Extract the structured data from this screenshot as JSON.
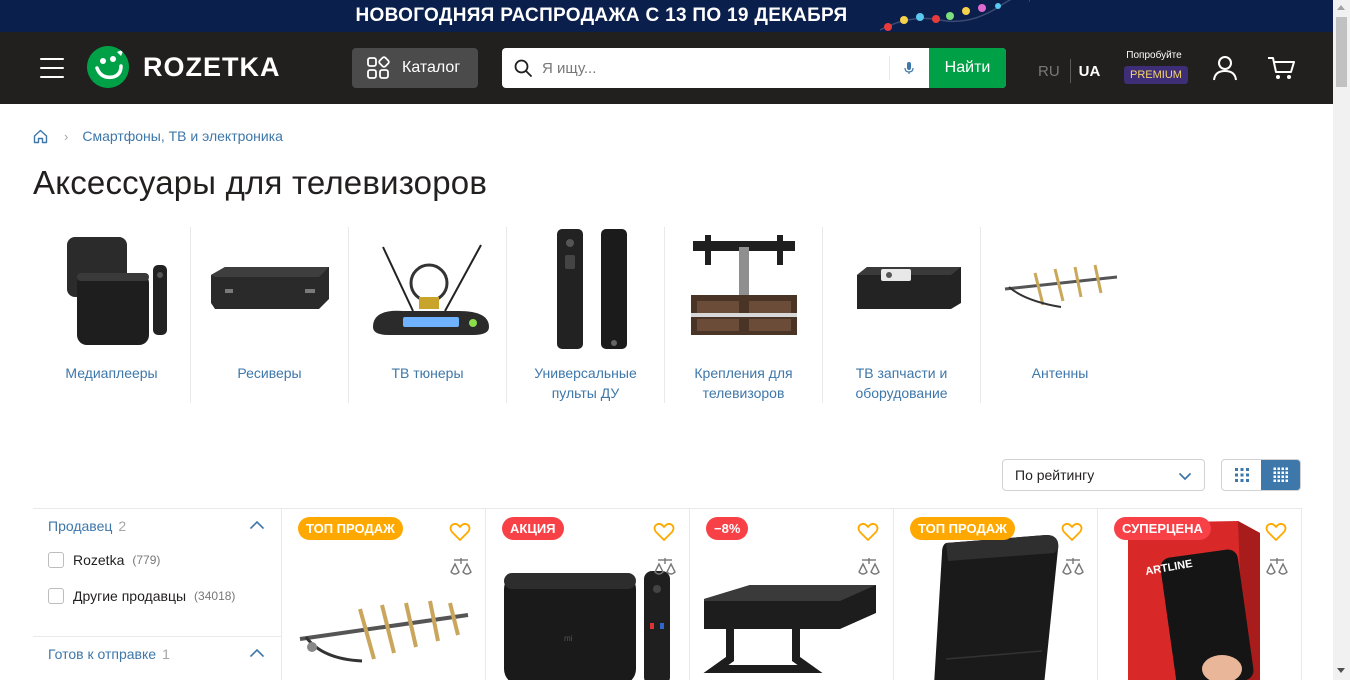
{
  "promo": {
    "text": "НОВОГОДНЯЯ РАСПРОДАЖА С 13 ПО 19 ДЕКАБРЯ"
  },
  "header": {
    "logo": "ROZETKA",
    "catalog_label": "Каталог",
    "search_placeholder": "Я ищу...",
    "search_button": "Найти",
    "lang_ru": "RU",
    "lang_ua": "UA",
    "premium_try": "Попробуйте",
    "premium_badge": "PREMIUM"
  },
  "breadcrumb": {
    "item": "Смартфоны, ТВ и электроника"
  },
  "page_title": "Аксессуары для телевизоров",
  "categories": [
    {
      "label": "Медиаплееры",
      "icon": "media-player"
    },
    {
      "label": "Ресиверы",
      "icon": "receiver"
    },
    {
      "label": "ТВ тюнеры",
      "icon": "tv-tuner"
    },
    {
      "label": "Универсальные пульты ДУ",
      "icon": "remote-control"
    },
    {
      "label": "Крепления для телевизоров",
      "icon": "tv-mount"
    },
    {
      "label": "ТВ запчасти и оборудование",
      "icon": "tv-parts"
    },
    {
      "label": "Антенны",
      "icon": "antenna"
    }
  ],
  "sort": {
    "selected": "По рейтингу"
  },
  "filters": [
    {
      "title": "Продавец",
      "count": "2",
      "options": [
        {
          "label": "Rozetka",
          "count": "(779)"
        },
        {
          "label": "Другие продавцы",
          "count": "(34018)"
        }
      ]
    },
    {
      "title": "Готов к отправке",
      "count": "1",
      "options": []
    }
  ],
  "products": [
    {
      "badge": "ТОП ПРОДАЖ",
      "badge_color": "#ffa900",
      "image": "antenna"
    },
    {
      "badge": "АКЦИЯ",
      "badge_color": "#f84147",
      "image": "media-box"
    },
    {
      "badge": "−8%",
      "badge_color": "#f84147",
      "image": "tv-stand"
    },
    {
      "badge": "ТОП ПРОДАЖ",
      "badge_color": "#ffa900",
      "image": "flat-antenna"
    },
    {
      "badge": "СУПЕРЦЕНА",
      "badge_color": "#f84147",
      "image": "artline-box"
    }
  ],
  "colors": {
    "brand_green": "#00a046",
    "link_blue": "#3e77aa",
    "header_dark": "#221f1f",
    "promo_navy": "#0b1f4d"
  }
}
